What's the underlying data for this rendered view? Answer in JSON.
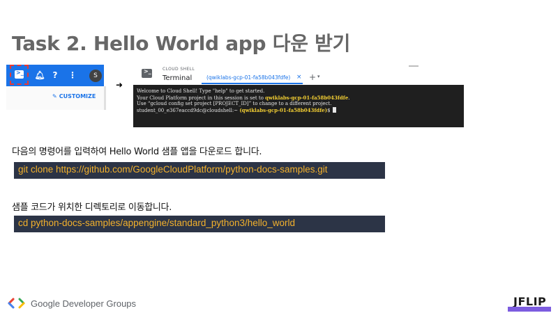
{
  "title": "Task 2. Hello World app 다운 받기",
  "gcp_toolbar": {
    "shell_icon": "cloud-shell-icon",
    "bell_icon": "notifications-icon",
    "help_icon": "help-icon",
    "more_icon": "more-vert-icon",
    "avatar_letter": "S",
    "customize_label": "CUSTOMIZE",
    "accent_color": "#1a73e8",
    "highlight_color": "#e53935"
  },
  "cloud_shell": {
    "header_small": "CLOUD SHELL",
    "header_title": "Terminal",
    "tab_label": "(qwiklabs-gcp-01-fa58b043fdfe)",
    "close_glyph": "×",
    "add_glyph": "+",
    "dropdown_glyph": "▾"
  },
  "terminal": {
    "line1": "Welcome to Cloud Shell! Type \"help\" to get started.",
    "line2_prefix": "Your Cloud Platform project in this session is set to ",
    "line2_project": "qwiklabs-gcp-01-fa58b043fdfe",
    "line2_suffix": ".",
    "line3": "Use “gcloud config set project [PROJECT_ID]” to change to a different project.",
    "line4_prompt": "student_00_e367eaccd9dc@cloudshell:~",
    "line4_project": "(qwiklabs-gcp-01-fa58b043fdfe)",
    "line4_dollar": "$"
  },
  "steps": [
    {
      "text": "다음의 명령어를 입력하여 Hello World 샘플 앱을 다운로드 합니다.",
      "command": "git clone https://github.com/GoogleCloudPlatform/python-docs-samples.git"
    },
    {
      "text": "샘플 코드가 위치한 디렉토리로 이동합니다.",
      "command": "cd python-docs-samples/appengine/standard_python3/hello_world"
    }
  ],
  "footer": {
    "gdg_label": "Google Developer Groups",
    "brand": "JFLIP"
  }
}
